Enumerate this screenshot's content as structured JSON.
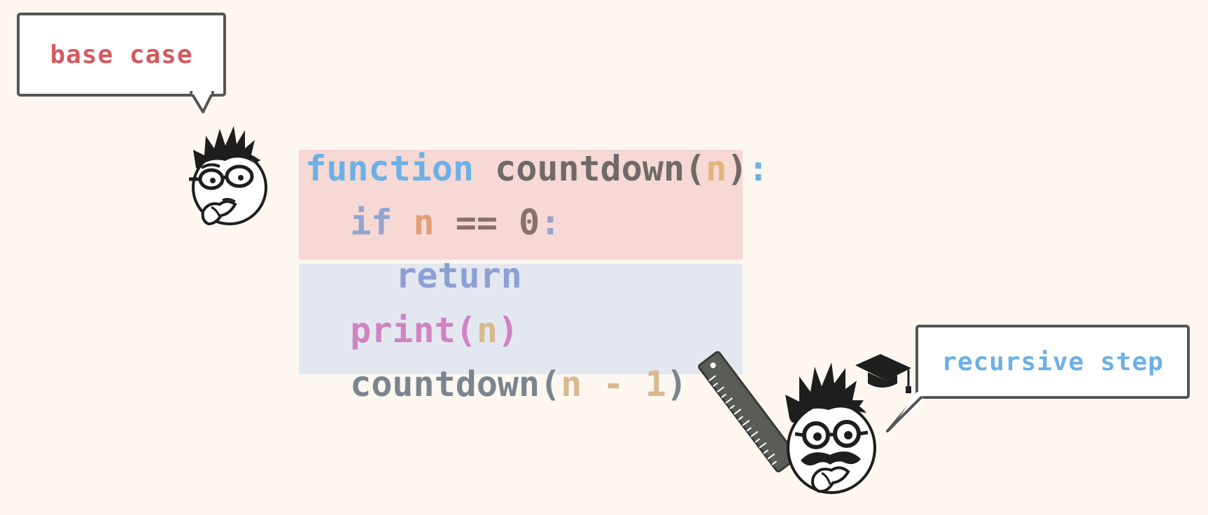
{
  "bubbles": {
    "base_case": "base case",
    "recursive_step": "recursive step"
  },
  "code": {
    "line1": {
      "keyword": "function",
      "name": "countdown",
      "open": "(",
      "param": "n",
      "close": ")",
      "colon": ":"
    },
    "line2": {
      "keyword": "if",
      "var": "n",
      "op": "==",
      "num": "0",
      "colon": ":"
    },
    "line3": {
      "keyword": "return"
    },
    "line4": {
      "name": "print",
      "open": "(",
      "arg": "n",
      "close": ")"
    },
    "line5": {
      "name": "countdown",
      "open": "(",
      "var": "n",
      "op": "-",
      "num": "1",
      "close": ")"
    }
  },
  "colors": {
    "base_block": "#f6d8d5",
    "recursive_block": "#e3e8f0",
    "base_label": "#d35a5f",
    "recursive_label": "#6cb0e6"
  },
  "icons": [
    "thinking-character-icon",
    "professor-character-icon",
    "ruler-icon",
    "graduation-cap-icon"
  ]
}
